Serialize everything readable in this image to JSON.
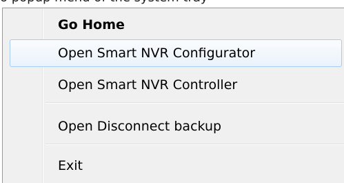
{
  "background_caption": "o popup menu of the system tray",
  "menu": {
    "items": [
      {
        "label": "Go Home",
        "bold": true
      },
      {
        "label": "Open Smart NVR Configurator",
        "highlighted": true
      },
      {
        "label": "Open Smart NVR Controller"
      },
      {
        "label": "Open Disconnect backup"
      },
      {
        "label": "Exit"
      }
    ]
  },
  "colors": {
    "menu_background": "#f0f0f0",
    "highlight_border": "#a8cbf1",
    "highlight_fill": "#eaf2fb",
    "text": "#000000"
  }
}
